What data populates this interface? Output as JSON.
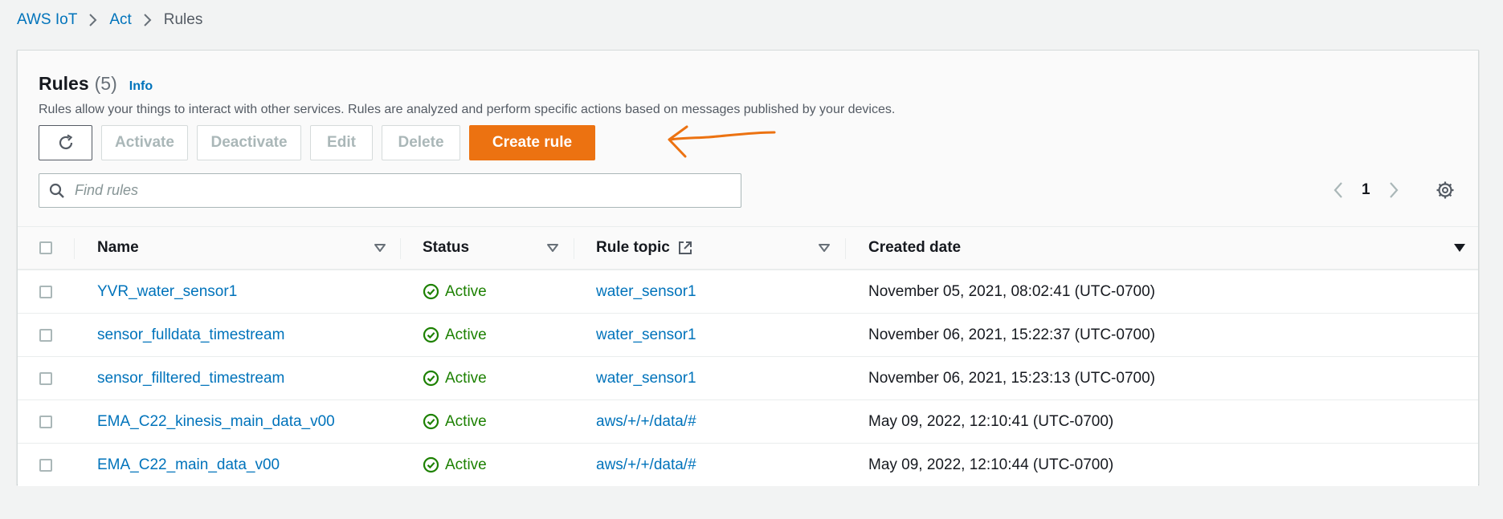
{
  "breadcrumb": {
    "items": [
      "AWS IoT",
      "Act"
    ],
    "current": "Rules"
  },
  "panel": {
    "title": "Rules",
    "count": "(5)",
    "info": "Info",
    "description": "Rules allow your things to interact with other services. Rules are analyzed and perform specific actions based on messages published by your devices."
  },
  "toolbar": {
    "activate": "Activate",
    "deactivate": "Deactivate",
    "edit": "Edit",
    "delete": "Delete",
    "create": "Create rule"
  },
  "search": {
    "placeholder": "Find rules",
    "value": ""
  },
  "pagination": {
    "page": "1"
  },
  "table": {
    "columns": {
      "name": "Name",
      "status": "Status",
      "topic": "Rule topic",
      "date": "Created date"
    },
    "rows": [
      {
        "name": "YVR_water_sensor1",
        "status": "Active",
        "topic": "water_sensor1",
        "date": "November 05, 2021, 08:02:41 (UTC-0700)"
      },
      {
        "name": "sensor_fulldata_timestream",
        "status": "Active",
        "topic": "water_sensor1",
        "date": "November 06, 2021, 15:22:37 (UTC-0700)"
      },
      {
        "name": "sensor_filltered_timestream",
        "status": "Active",
        "topic": "water_sensor1",
        "date": "November 06, 2021, 15:23:13 (UTC-0700)"
      },
      {
        "name": "EMA_C22_kinesis_main_data_v00",
        "status": "Active",
        "topic": "aws/+/+/data/#",
        "date": "May 09, 2022, 12:10:41 (UTC-0700)"
      },
      {
        "name": "EMA_C22_main_data_v00",
        "status": "Active",
        "topic": "aws/+/+/data/#",
        "date": "May 09, 2022, 12:10:44 (UTC-0700)"
      }
    ]
  },
  "colors": {
    "link": "#0073bb",
    "primary": "#ec7211",
    "success": "#1d8102",
    "annotation": "#ec7211"
  },
  "icons": [
    "chevron-right-icon",
    "refresh-icon",
    "search-icon",
    "chevron-left-icon",
    "gear-icon",
    "sort-icon",
    "external-link-icon",
    "check-circle-icon",
    "arrow-annotation-icon"
  ]
}
